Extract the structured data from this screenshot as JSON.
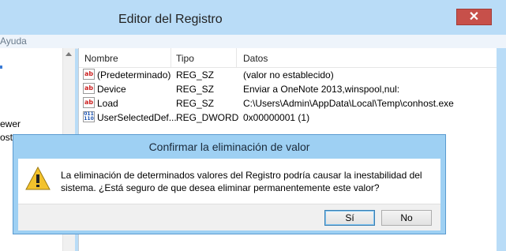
{
  "window": {
    "title": "Editor del Registro",
    "close_label": "✕"
  },
  "menu": {
    "help_label": "Ayuda"
  },
  "tree": {
    "items": [
      "ewer",
      "ost"
    ]
  },
  "list": {
    "headers": [
      "Nombre",
      "Tipo",
      "Datos"
    ],
    "rows": [
      {
        "icon": "string-value-icon",
        "name": "(Predeterminado)",
        "type": "REG_SZ",
        "data": "(valor no establecido)"
      },
      {
        "icon": "string-value-icon",
        "name": "Device",
        "type": "REG_SZ",
        "data": "Enviar a OneNote 2013,winspool,nul:"
      },
      {
        "icon": "string-value-icon",
        "name": "Load",
        "type": "REG_SZ",
        "data": "C:\\Users\\Admin\\AppData\\Local\\Temp\\conhost.exe"
      },
      {
        "icon": "binary-value-icon",
        "name": "UserSelectedDef...",
        "type": "REG_DWORD",
        "data": "0x00000001 (1)"
      }
    ]
  },
  "dialog": {
    "title": "Confirmar la eliminación de valor",
    "message": "La eliminación de determinados valores del Registro podría causar la inestabilidad del sistema. ¿Está seguro de que desea eliminar permanentemente este valor?",
    "yes_label": "Sí",
    "no_label": "No"
  },
  "colors": {
    "frame": "#b9dcf7",
    "close": "#c7504a",
    "dialog_frame": "#9ed0f3",
    "string_icon": "#cc2222",
    "binary_icon": "#1a52b0"
  }
}
